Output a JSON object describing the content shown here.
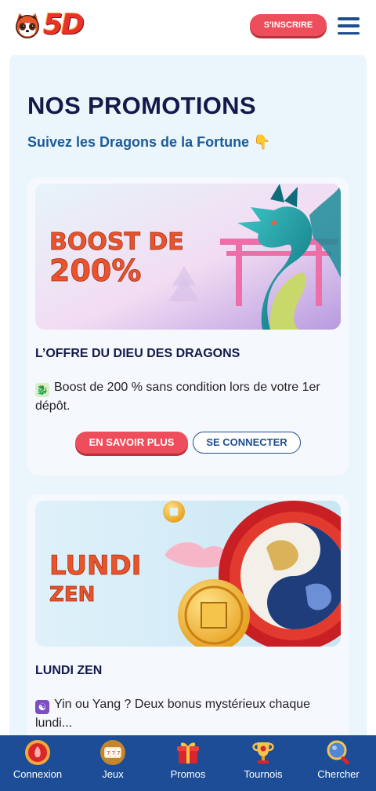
{
  "header": {
    "logo_text": "5D",
    "signup_label": "S'INSCRIRE",
    "menu_icon": "hamburger-menu-icon"
  },
  "page": {
    "title": "NOS PROMOTIONS",
    "subtitle": "Suivez les Dragons de la Fortune 👇"
  },
  "promotions": [
    {
      "banner_text_line1": "BOOST DE",
      "banner_text_line2": "200%",
      "title": "L’OFFRE DU DIEU DES DRAGONS",
      "emoji": "🐉",
      "description": "Boost de 200 % sans condition lors de votre 1er dépôt.",
      "more_label": "EN SAVOIR PLUS",
      "connect_label": "SE CONNECTER"
    },
    {
      "banner_text_line1": "LUNDI",
      "banner_text_line2": "ZEN",
      "title": "LUNDI ZEN",
      "emoji": "☯",
      "description": "Yin ou Yang ? Deux bonus mystérieux chaque lundi..."
    }
  ],
  "bottom_nav": [
    {
      "label": "Connexion",
      "icon": "login-icon"
    },
    {
      "label": "Jeux",
      "icon": "slot-machine-icon"
    },
    {
      "label": "Promos",
      "icon": "gift-icon"
    },
    {
      "label": "Tournois",
      "icon": "trophy-icon"
    },
    {
      "label": "Chercher",
      "icon": "search-icon"
    }
  ],
  "colors": {
    "accent_red": "#ee4e5b",
    "navy": "#14194a",
    "blue": "#1d4e8c",
    "panel_bg": "#eaf6fb",
    "nav_bg": "#1c4d96"
  }
}
